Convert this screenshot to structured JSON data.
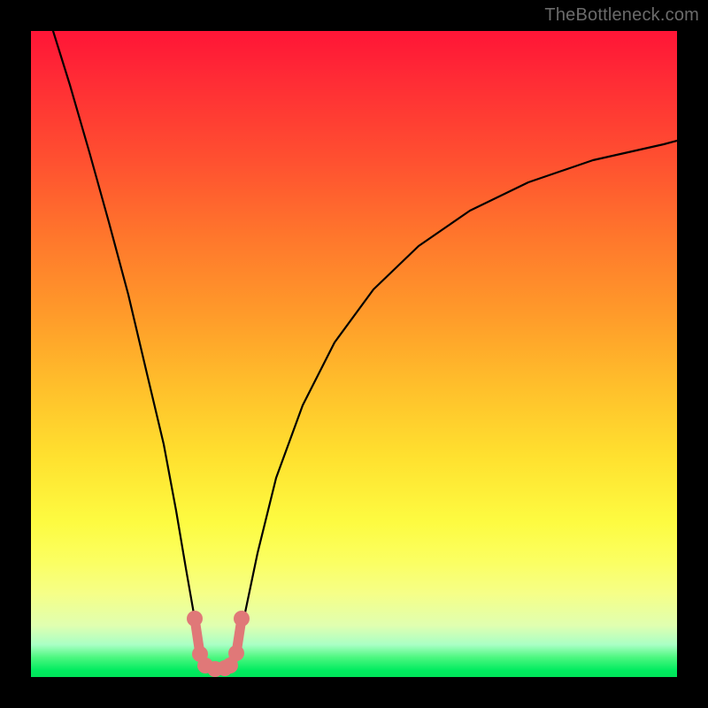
{
  "watermark": "TheBottleneck.com",
  "chart_data": {
    "type": "line",
    "title": "",
    "xlabel": "",
    "ylabel": "",
    "xlim": [
      0,
      1
    ],
    "ylim": [
      0,
      1
    ],
    "series": [
      {
        "name": "curve",
        "x": [
          0.035,
          0.06,
          0.09,
          0.12,
          0.15,
          0.18,
          0.205,
          0.225,
          0.24,
          0.253,
          0.262,
          0.27,
          0.278,
          0.285,
          0.292,
          0.3,
          0.308,
          0.318,
          0.332,
          0.35,
          0.38,
          0.42,
          0.47,
          0.53,
          0.6,
          0.68,
          0.77,
          0.87,
          0.98,
          1.0
        ],
        "y": [
          1.0,
          0.916,
          0.812,
          0.704,
          0.592,
          0.47,
          0.36,
          0.258,
          0.168,
          0.09,
          0.036,
          0.018,
          0.014,
          0.012,
          0.012,
          0.014,
          0.018,
          0.037,
          0.1,
          0.192,
          0.308,
          0.42,
          0.518,
          0.6,
          0.668,
          0.722,
          0.766,
          0.8,
          0.825,
          0.83
        ]
      }
    ],
    "markers": {
      "name": "highlight-points",
      "color": "#e07878",
      "x": [
        0.253,
        0.262,
        0.27,
        0.278,
        0.285,
        0.292,
        0.3,
        0.308,
        0.318
      ],
      "y": [
        0.09,
        0.036,
        0.018,
        0.014,
        0.012,
        0.014,
        0.018,
        0.037,
        0.09
      ]
    },
    "gradient_stops": [
      {
        "pos": 0.0,
        "color": "#ff1537"
      },
      {
        "pos": 0.5,
        "color": "#ffb22b"
      },
      {
        "pos": 0.8,
        "color": "#fdfe4a"
      },
      {
        "pos": 1.0,
        "color": "#00e459"
      }
    ]
  }
}
